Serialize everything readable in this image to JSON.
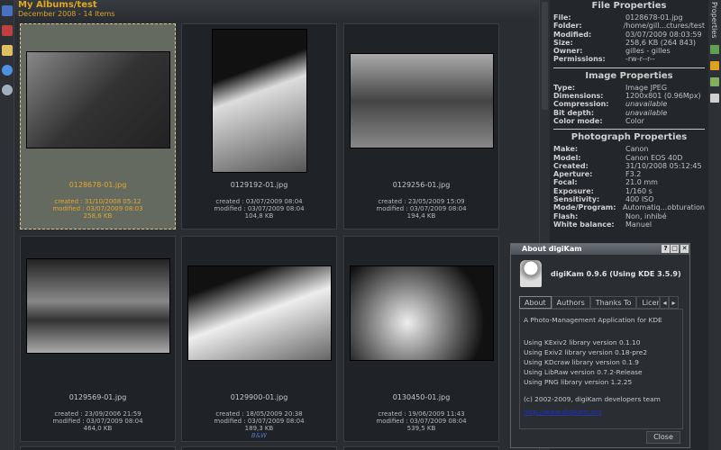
{
  "header": {
    "title": "My Albums/test",
    "subtitle": "December 2008 - 14 Items"
  },
  "items": [
    {
      "name": "0128678-01.jpg",
      "created": "created : 31/10/2008 05:12",
      "modified": "modified : 03/07/2009 08:03",
      "size": "258,6 KB",
      "selected": true
    },
    {
      "name": "0129192-01.jpg",
      "created": "created : 03/07/2009 08:04",
      "modified": "modified : 03/07/2009 08:04",
      "size": "104,8 KB"
    },
    {
      "name": "0129256-01.jpg",
      "created": "created : 23/05/2009 15:09",
      "modified": "modified : 03/07/2009 08:04",
      "size": "194,4 KB"
    },
    {
      "name": "0129569-01.jpg",
      "created": "created : 23/09/2006 21:59",
      "modified": "modified : 03/07/2009 08:04",
      "size": "464,0 KB"
    },
    {
      "name": "0129900-01.jpg",
      "created": "created : 18/05/2009 20:38",
      "modified": "modified : 03/07/2009 08:04",
      "size": "189,3 KB",
      "tag": "B&W"
    },
    {
      "name": "0130450-01.jpg",
      "created": "created : 19/06/2009 11:43",
      "modified": "modified : 03/07/2009 08:04",
      "size": "539,5 KB"
    }
  ],
  "file_props": {
    "title": "File Properties",
    "rows": [
      [
        "File:",
        "0128678-01.jpg"
      ],
      [
        "Folder:",
        "/home/gill...ctures/test"
      ],
      [
        "Modified:",
        "03/07/2009 08:03:59"
      ],
      [
        "Size:",
        "258,6 KB (264 843)"
      ],
      [
        "Owner:",
        "gilles - gilles"
      ],
      [
        "Permissions:",
        "-rw-r--r--"
      ]
    ]
  },
  "image_props": {
    "title": "Image Properties",
    "rows": [
      [
        "Type:",
        "Image JPEG"
      ],
      [
        "Dimensions:",
        "1200x801 (0.96Mpx)"
      ],
      [
        "Compression:",
        "unavailable"
      ],
      [
        "Bit depth:",
        "unavailable"
      ],
      [
        "Color mode:",
        "Color"
      ]
    ]
  },
  "photo_props": {
    "title": "Photograph Properties",
    "rows": [
      [
        "Make:",
        "Canon"
      ],
      [
        "Model:",
        "Canon EOS 40D"
      ],
      [
        "Created:",
        "31/10/2008 05:12:45"
      ],
      [
        "Aperture:",
        "F3.2"
      ],
      [
        "Focal:",
        "21.0 mm"
      ],
      [
        "Exposure:",
        "1/160 s"
      ],
      [
        "Sensitivity:",
        "400 ISO"
      ],
      [
        "Mode/Program:",
        "Automatiq...obturation"
      ],
      [
        "Flash:",
        "Non, inhibé"
      ],
      [
        "White balance:",
        "Manuel"
      ]
    ]
  },
  "right_tab": "Properties",
  "dialog": {
    "title": "About digiKam",
    "help": "?",
    "max": "□",
    "close_x": "✕",
    "heading": "digiKam 0.9.6 (Using KDE 3.5.9)",
    "tabs": [
      "About",
      "Authors",
      "Thanks To",
      "Licen"
    ],
    "scroll_left": "◂",
    "scroll_right": "▸",
    "lines": [
      "A Photo-Management Application for KDE",
      "",
      "Using KExiv2 library version 0.1.10",
      "Using Exiv2 library version 0.18-pre2",
      "Using KDcraw library version 0.1.9",
      "Using LibRaw version 0.7.2-Release",
      "Using PNG library version 1.2.25",
      "",
      "(c) 2002-2009, digiKam developers team"
    ],
    "link": "http://www.digikam.org",
    "close": "Close"
  }
}
